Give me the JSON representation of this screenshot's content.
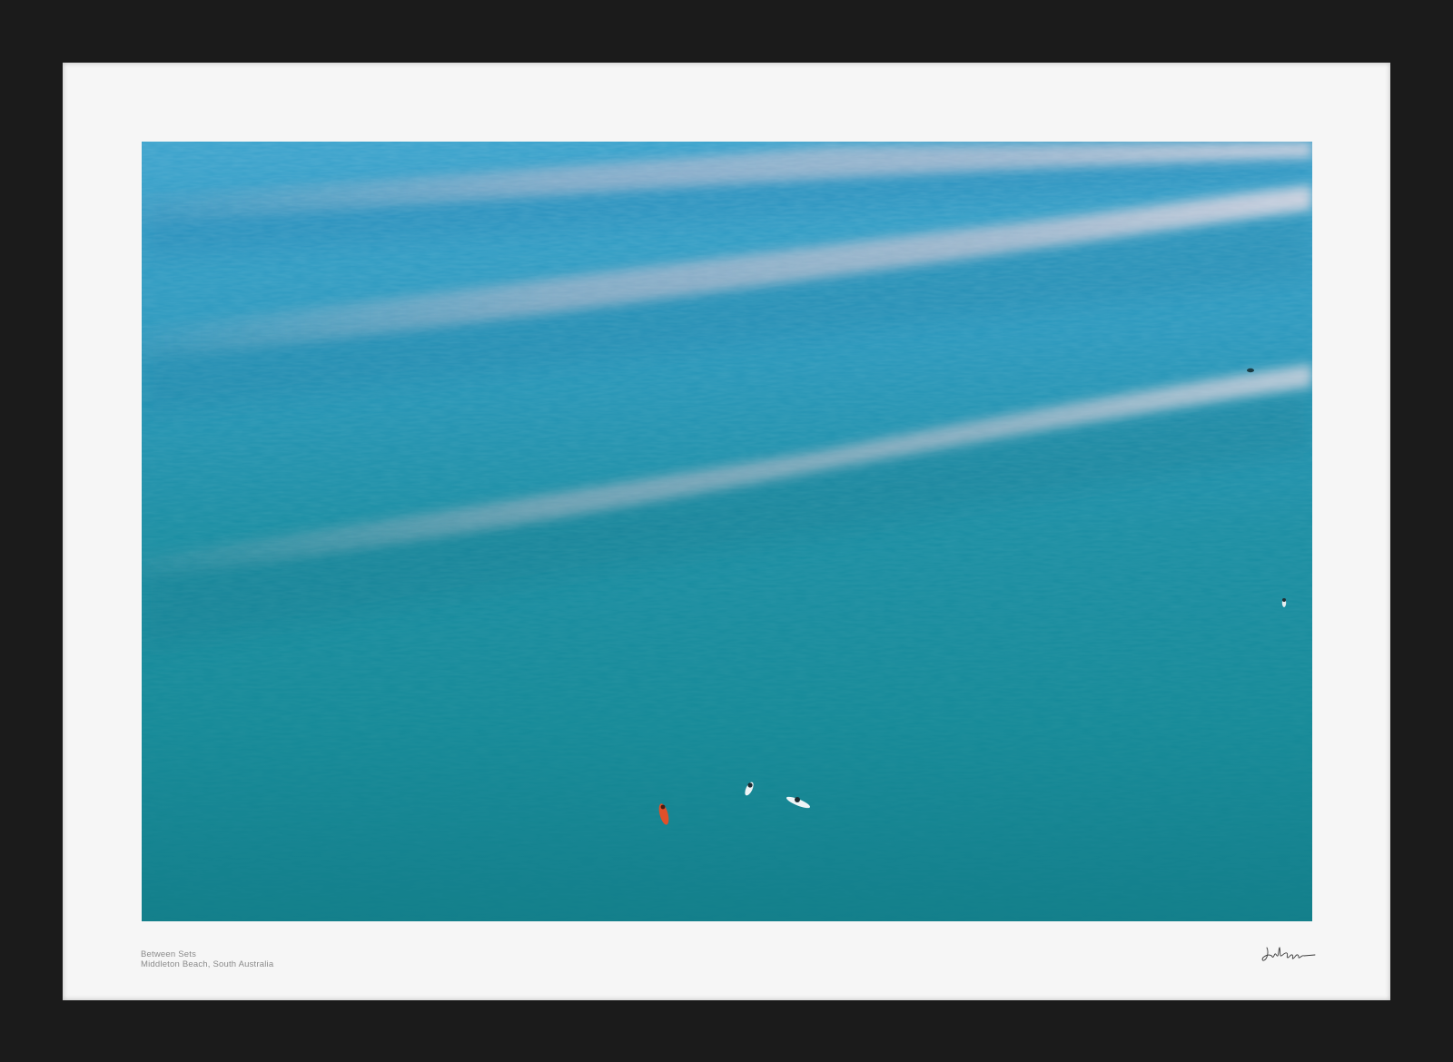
{
  "print": {
    "title": "Between Sets",
    "location": "Middleton Beach, South Australia",
    "signature": "Josh Gregson"
  },
  "photo": {
    "subject": "aerial-ocean-surfers",
    "surfers_visible": 6,
    "colors": {
      "deep_water": "#127f8d",
      "mid_water": "#1e94a8",
      "upper_water": "#2fa0c4",
      "swell_highlight": "#e8b9c6",
      "orange_board": "#e0502a",
      "white_board": "#eef4f6",
      "frame": "#1b1b1b",
      "mat": "#f6f6f6"
    }
  }
}
